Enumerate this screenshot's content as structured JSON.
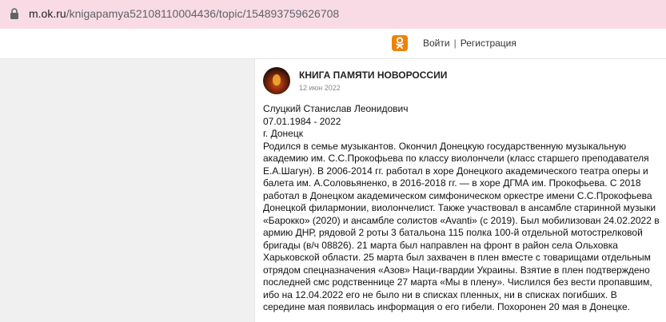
{
  "browser": {
    "url_host": "m.ok.ru",
    "url_path": "/knigapamya52108110004436/topic/154893759626708"
  },
  "header": {
    "login_label": "Войти",
    "separator": "|",
    "register_label": "Регистрация",
    "logo_icon": "odnoklassniki-icon",
    "brand_color": "#ee8208"
  },
  "post": {
    "group_name": "КНИГА ПАМЯТИ НОВОРОССИИ",
    "date": "12 июн 2022",
    "lines": [
      "Слуцкий Станислав Леонидович",
      "07.01.1984 - 2022",
      "г. Донецк",
      "Родился в семье музыкантов. Окончил Донецкую государственную музыкальную академию им. С.С.Прокофьева по классу виолончели (класс старшего преподавателя Е.А.Шагун). В 2006-2014 гг. работал в хоре Донецкого академического театра оперы и балета им. А.Соловьяненко, в 2016-2018 гг. — в хоре ДГМА им. Прокофьева. С 2018 работал в Донецком академическом симфоническом оркестре имени С.С.Прокофьева Донецкой филармонии, виолончелист. Также участвовал в ансамбле старинной музыки «Барокко» (2020) и ансамбле солистов «Avanti» (с 2019). Был мобилизован 24.02.2022 в армию ДНР, рядовой 2 роты 3 батальона 115 полка 100-й отдельной мотострелковой бригады (в/ч 08826). 21 марта был направлен на фронт в район села Ольховка Харьковской области. 25 марта был захвачен в плен вместе с товарищами отдельным отрядом спецназначения «Азов» Наци-гвардии Украины. Взятие в плен подтверждено последней смс родственнице 27 марта «Мы в плену». Числился без вести пропавшим, ибо на 12.04.2022 его не было ни в списках пленных, ни в списках погибших. В середине мая появилась информация о его гибели. Похоронен 20 мая в Донецке."
    ]
  }
}
